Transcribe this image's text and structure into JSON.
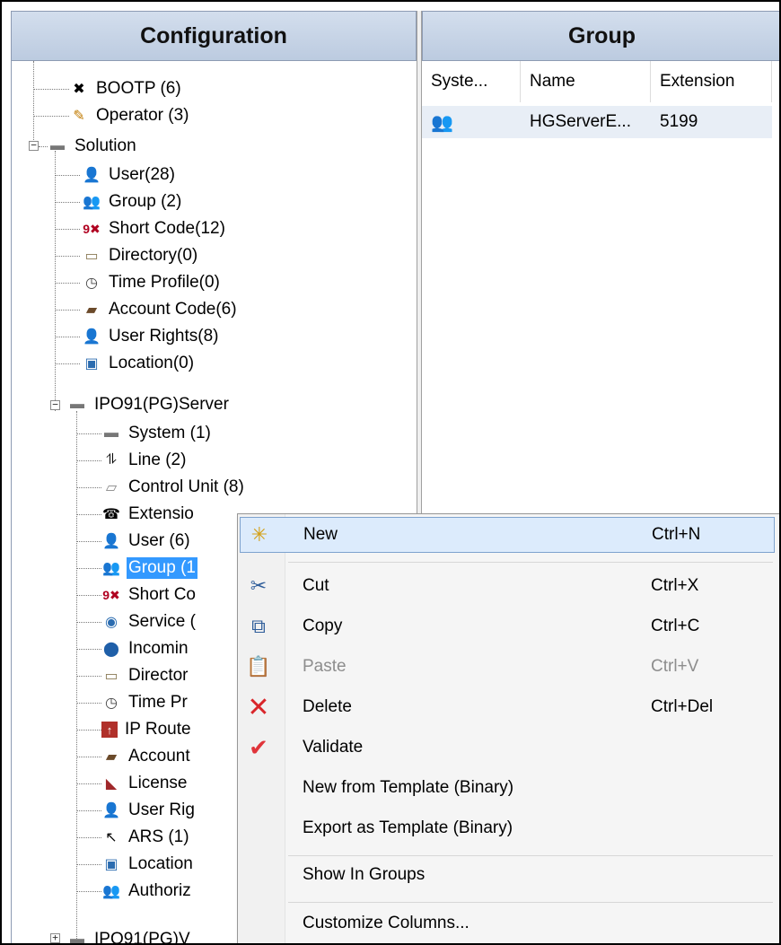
{
  "panes": {
    "configuration_title": "Configuration",
    "group_title": "Group"
  },
  "tree": {
    "items": [
      {
        "label": "BOOTP (6)",
        "icon": "bootp-icon"
      },
      {
        "label": "Operator (3)",
        "icon": "operator-icon"
      },
      {
        "label": "Solution",
        "icon": "solution-icon"
      },
      {
        "label": "User(28)",
        "icon": "user-icon"
      },
      {
        "label": "Group (2)",
        "icon": "group-icon"
      },
      {
        "label": "Short Code(12)",
        "icon": "short-code-icon"
      },
      {
        "label": "Directory(0)",
        "icon": "directory-icon"
      },
      {
        "label": "Time Profile(0)",
        "icon": "time-profile-icon"
      },
      {
        "label": "Account Code(6)",
        "icon": "account-code-icon"
      },
      {
        "label": "User Rights(8)",
        "icon": "user-rights-icon"
      },
      {
        "label": "Location(0)",
        "icon": "location-icon"
      },
      {
        "label": "IPO91(PG)Server",
        "icon": "server-icon"
      },
      {
        "label": "System (1)",
        "icon": "system-icon"
      },
      {
        "label": "Line (2)",
        "icon": "line-icon"
      },
      {
        "label": "Control Unit (8)",
        "icon": "control-unit-icon"
      },
      {
        "label": "Extensio",
        "icon": "extension-icon"
      },
      {
        "label": "User (6)",
        "icon": "user-icon"
      },
      {
        "label": "Group (1",
        "icon": "group-icon"
      },
      {
        "label": "Short Co",
        "icon": "short-code-icon"
      },
      {
        "label": "Service (",
        "icon": "service-icon"
      },
      {
        "label": "Incomin",
        "icon": "incoming-icon"
      },
      {
        "label": "Director",
        "icon": "directory-icon"
      },
      {
        "label": "Time Pr",
        "icon": "time-profile-icon"
      },
      {
        "label": "IP Route",
        "icon": "ip-route-icon"
      },
      {
        "label": "Account",
        "icon": "account-code-icon"
      },
      {
        "label": "License",
        "icon": "license-icon"
      },
      {
        "label": "User Rig",
        "icon": "user-rights-icon"
      },
      {
        "label": "ARS (1)",
        "icon": "ars-icon"
      },
      {
        "label": "Location",
        "icon": "location-icon"
      },
      {
        "label": "Authoriz",
        "icon": "authorization-icon"
      },
      {
        "label": "IPO91(PG)V",
        "icon": "server-icon"
      }
    ]
  },
  "list": {
    "columns": [
      "Syste...",
      "Name",
      "Extension"
    ],
    "rows": [
      {
        "system_icon": "group-icon",
        "name": "HGServerE...",
        "extension": "5199"
      }
    ]
  },
  "context_menu": {
    "items": [
      {
        "label": "New",
        "shortcut": "Ctrl+N",
        "icon": "new-icon"
      },
      {
        "label": "Cut",
        "shortcut": "Ctrl+X",
        "icon": "cut-icon"
      },
      {
        "label": "Copy",
        "shortcut": "Ctrl+C",
        "icon": "copy-icon"
      },
      {
        "label": "Paste",
        "shortcut": "Ctrl+V",
        "icon": "paste-icon"
      },
      {
        "label": "Delete",
        "shortcut": "Ctrl+Del",
        "icon": "delete-icon"
      },
      {
        "label": "Validate",
        "shortcut": "",
        "icon": "validate-icon"
      },
      {
        "label": "New from Template (Binary)",
        "shortcut": ""
      },
      {
        "label": "Export as Template (Binary)",
        "shortcut": ""
      },
      {
        "label": "Show In Groups",
        "shortcut": ""
      },
      {
        "label": "Customize Columns...",
        "shortcut": ""
      }
    ]
  },
  "colors": {
    "header_bg": "#c8d5e8",
    "selection": "#3399ff",
    "menu_highlight": "#dcebfc"
  }
}
